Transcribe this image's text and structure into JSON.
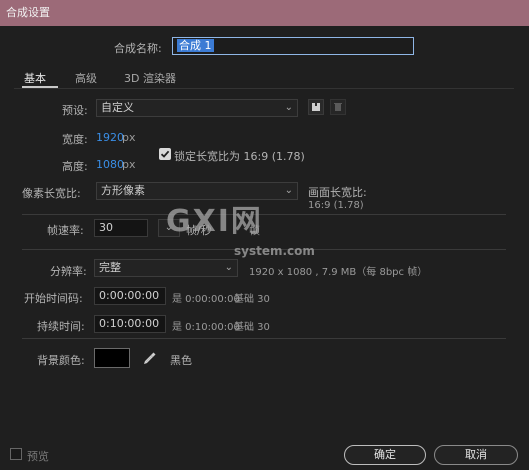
{
  "window": {
    "title": "合成设置"
  },
  "comp_name": {
    "label": "合成名称:",
    "value": "合成 1"
  },
  "tabs": [
    {
      "label": "基本"
    },
    {
      "label": "高级"
    },
    {
      "label": "3D 渲染器"
    }
  ],
  "preset": {
    "label": "预设:",
    "value": "自定义"
  },
  "width": {
    "label": "宽度:",
    "value": "1920",
    "unit": "px"
  },
  "height": {
    "label": "高度:",
    "value": "1080",
    "unit": "px"
  },
  "lock_aspect": {
    "label": "锁定长宽比为 16:9 (1.78)",
    "checked": true
  },
  "pixel_aspect": {
    "label": "像素长宽比:",
    "value": "方形像素"
  },
  "frame_aspect": {
    "label": "画面长宽比:",
    "value": "16:9 (1.78)"
  },
  "frame_rate": {
    "label": "帧速率:",
    "value": "30",
    "unit": "帧/秒",
    "extra": "帧"
  },
  "resolution": {
    "label": "分辨率:",
    "value": "完整",
    "info": "1920 x 1080 , 7.9 MB（每 8bpc 帧）"
  },
  "start_timecode": {
    "label": "开始时间码:",
    "value": "0:00:00:00",
    "info_prefix": "是 0:00:00:00",
    "info_base": "基础 30"
  },
  "duration": {
    "label": "持续时间:",
    "value": "0:10:00:00",
    "info_prefix": "是 0:10:00:00",
    "info_base": "基础 30"
  },
  "background_color": {
    "label": "背景颜色:",
    "swatch": "#000000",
    "name": "黑色"
  },
  "preview": {
    "label": "预览",
    "checked": false
  },
  "buttons": {
    "ok": "确定",
    "cancel": "取消"
  },
  "watermark": {
    "big": "GXI网",
    "small": "system.com"
  },
  "colors": {
    "titlebar": "#9c6a78",
    "accent_blue": "#3a8ee6",
    "bg": "#1f1f1f"
  }
}
